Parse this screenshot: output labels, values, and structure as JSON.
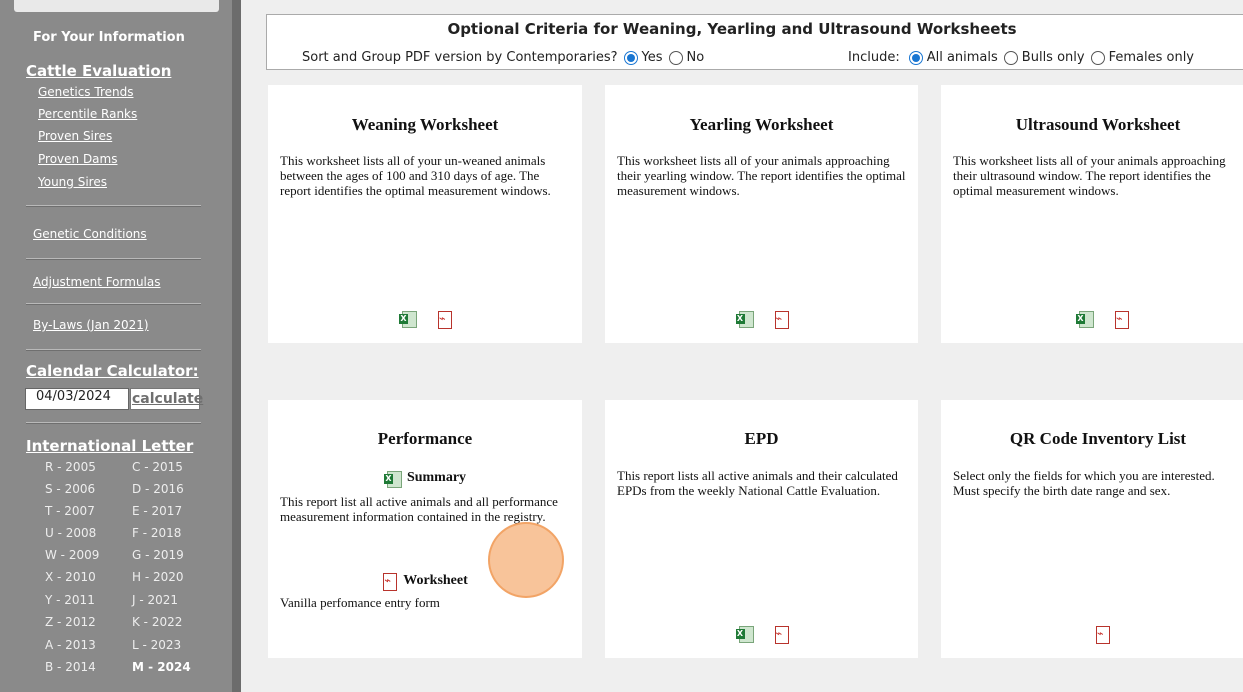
{
  "sidebar": {
    "for_your_information": "For Your Information",
    "cattle_evaluation": "Cattle Evaluation",
    "cattle_links": [
      "Genetics Trends",
      "Percentile Ranks",
      "Proven Sires",
      "Proven Dams",
      "Young Sires"
    ],
    "genetic_conditions": "Genetic Conditions",
    "adjustment_formulas": "Adjustment Formulas",
    "bylaws_link": "By-Laws",
    "bylaws_date": " (Jan 2021)",
    "calendar_calculator": "Calendar Calculator:",
    "calendar_date": "04/03/2024",
    "calculate_label": "calculate",
    "international_letter": "International Letter",
    "letters": [
      [
        "R - 2005",
        "C - 2015"
      ],
      [
        "S - 2006",
        "D - 2016"
      ],
      [
        "T - 2007",
        "E - 2017"
      ],
      [
        "U - 2008",
        "F - 2018"
      ],
      [
        "W - 2009",
        "G - 2019"
      ],
      [
        "X - 2010",
        "H - 2020"
      ],
      [
        "Y - 2011",
        "J - 2021"
      ],
      [
        "Z - 2012",
        "K - 2022"
      ],
      [
        "A - 2013",
        "L - 2023"
      ],
      [
        "B - 2014",
        "M - 2024"
      ]
    ]
  },
  "criteria": {
    "title": "Optional Criteria for Weaning, Yearling and Ultrasound Worksheets",
    "sort_label": "Sort and Group PDF version by Contemporaries?",
    "yes": "Yes",
    "no": "No",
    "include_label": "Include:",
    "all_animals": "All animals",
    "bulls_only": "Bulls only",
    "females_only": "Females only",
    "sort_selected": "Yes",
    "include_selected": "All animals"
  },
  "cards": {
    "weaning": {
      "title": "Weaning Worksheet",
      "desc": "This worksheet lists all of your un-weaned animals between the ages of 100 and 310 days of age. The report identifies the optimal measurement windows."
    },
    "yearling": {
      "title": "Yearling Worksheet",
      "desc": "This worksheet lists all of your animals approaching their yearling window. The report identifies the optimal measurement windows."
    },
    "ultrasound": {
      "title": "Ultrasound Worksheet",
      "desc": "This worksheet lists all of your animals approaching their ultrasound window. The report identifies the optimal measurement windows."
    },
    "performance": {
      "title": "Performance",
      "summary": "Summary",
      "summary_desc": "This report list all active animals and all performance measurement information contained in the registry.",
      "worksheet": "Worksheet",
      "worksheet_desc": "Vanilla perfomance entry form"
    },
    "epd": {
      "title": "EPD",
      "desc": "This report lists all active animals and their calculated EPDs from the weekly National Cattle Evaluation."
    },
    "qr": {
      "title": "QR Code Inventory List",
      "desc": "Select only the fields for which you are interested. Must specify the birth date range and sex."
    }
  },
  "colors": {
    "sidebar": "#8a8a8a",
    "radio_selected": "#1976d2",
    "background": "#efefef"
  }
}
